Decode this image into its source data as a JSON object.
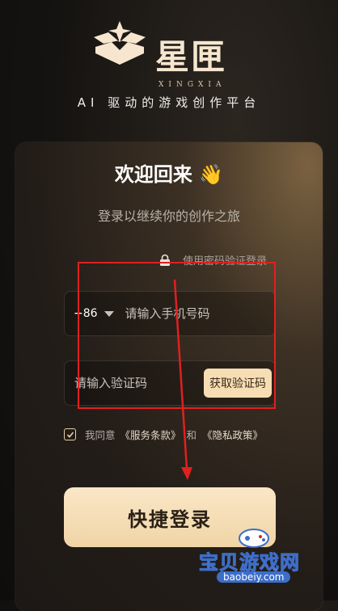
{
  "brand": {
    "name": "星匣",
    "pinyin": "XINGXIA",
    "tagline": "AI 驱动的游戏创作平台"
  },
  "login": {
    "welcome": "欢迎回来 👋",
    "subtitle": "登录以继续你的创作之旅",
    "password_login_link": "使用密码验证登录",
    "country_code": "+86",
    "phone_placeholder": "请输入手机号码",
    "code_placeholder": "请输入验证码",
    "get_code_button": "获取验证码",
    "agree_prefix": "我同意",
    "terms_link": "《服务条款》",
    "and": "和",
    "privacy_link": "《隐私政策》",
    "agree_checked": true,
    "submit_button": "快捷登录"
  },
  "watermark": {
    "text": "宝贝游戏网",
    "url": "baobeiy.com"
  },
  "colors": {
    "accent": "#f6ddb3",
    "annotation": "#e02020"
  }
}
